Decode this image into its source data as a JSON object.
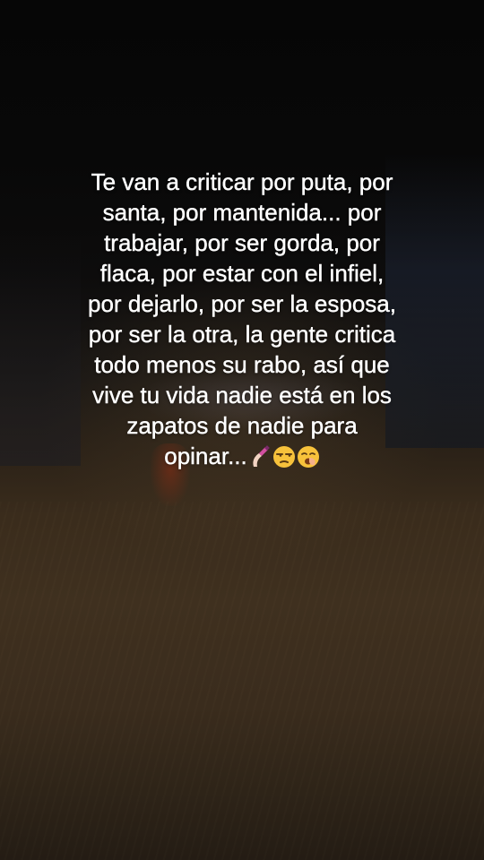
{
  "caption": {
    "text": "Te van a criticar por puta, por\nsanta, por mantenida... por\ntrabajar, por ser gorda, por\nflaca, por estar con el infiel,\npor dejarlo, por ser la esposa,\npor ser la otra, la gente critica\ntodo menos su rabo, así que\nvive tu vida nadie está en los\nzapatos de nadie para\nopinar...",
    "emojis": [
      "nail-polish-icon",
      "unamused-face-icon",
      "yawning-face-icon"
    ]
  },
  "colors": {
    "text": "#ffffff",
    "sky": "#060606",
    "road": "#3f301f"
  }
}
